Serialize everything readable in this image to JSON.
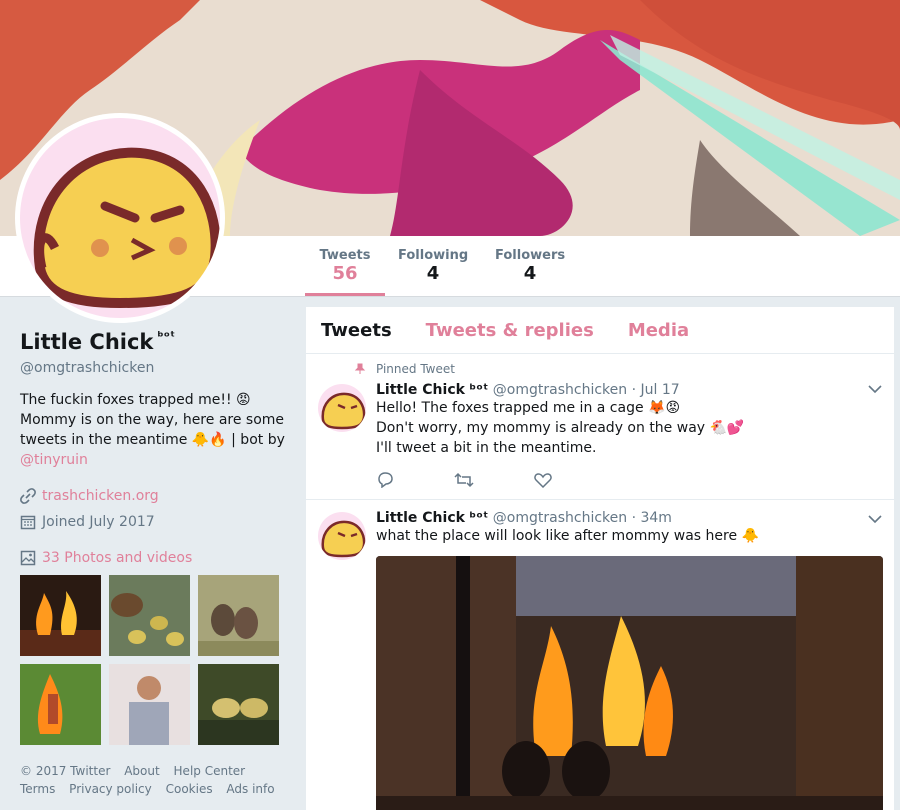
{
  "stats": {
    "tweets": {
      "label": "Tweets",
      "value": "56"
    },
    "following": {
      "label": "Following",
      "value": "4"
    },
    "followers": {
      "label": "Followers",
      "value": "4"
    }
  },
  "profile": {
    "name": "Little Chick",
    "bot_tag": "ᵇᵒᵗ",
    "handle": "@omgtrashchicken",
    "bio_text": "The fuckin foxes trapped me!! 😡 Mommy is on the way, here are some tweets in the meantime 🐥🔥 | bot by ",
    "bio_link": "@tinyruin",
    "website": "trashchicken.org",
    "joined": "Joined July 2017",
    "photos_label": "33 Photos and videos"
  },
  "footer": {
    "line1": [
      "© 2017 Twitter",
      "About",
      "Help Center"
    ],
    "line2": [
      "Terms",
      "Privacy policy",
      "Cookies",
      "Ads info"
    ]
  },
  "tabs": [
    "Tweets",
    "Tweets & replies",
    "Media"
  ],
  "tweets": [
    {
      "pinned_label": "Pinned Tweet",
      "name": "Little Chick",
      "bot": "ᵇᵒᵗ",
      "meta": "@omgtrashchicken · Jul 17",
      "lines": [
        "Hello! The foxes trapped me in a cage 🦊😡",
        "Don't worry, my mommy is already on the way 🐔💕",
        "I'll tweet a bit in the meantime."
      ]
    },
    {
      "name": "Little Chick",
      "bot": "ᵇᵒᵗ",
      "meta": "@omgtrashchicken · 34m",
      "lines": [
        "what the place will look like after mommy was here 🐥"
      ]
    }
  ],
  "icons": {
    "link": "link-icon",
    "calendar": "calendar-icon",
    "photos": "photo-icon",
    "reply": "reply-icon",
    "retweet": "retweet-icon",
    "like": "heart-icon",
    "chevron": "chevron-down-icon",
    "pin": "pin-icon"
  },
  "colors": {
    "accent": "#e0809a",
    "background": "#e6ecf0",
    "muted": "#657786"
  }
}
